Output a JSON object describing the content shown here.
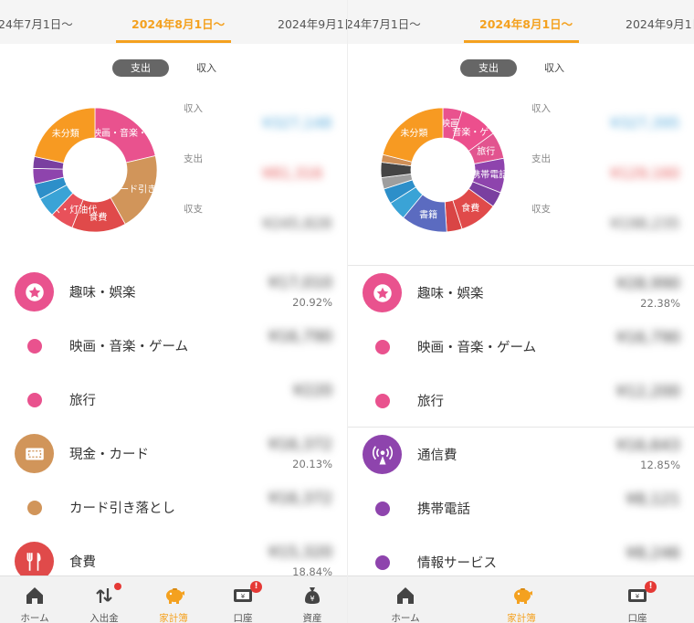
{
  "colors": {
    "accent": "#f4a11f",
    "income": "#4aa3d8",
    "expense": "#e35050",
    "balance": "#555555",
    "hobby": "#e9528e",
    "cash_card": "#d1955a",
    "food": "#e04a4a",
    "telecom": "#8e44ad",
    "uncategorized": "#f79a22",
    "books": "#5b6bc0"
  },
  "left": {
    "date_tabs": {
      "prev": "24年7月1日〜",
      "active": "2024年8月1日〜",
      "next": "2024年9月1日"
    },
    "toggle": {
      "expense": "支出",
      "income": "収入"
    },
    "donut": {
      "segments": [
        {
          "label": "映画・音楽・ゲ",
          "color": "#e9528e",
          "share": 0.2092
        },
        {
          "label": "カード引き落",
          "color": "#d1955a",
          "share": 0.2013
        },
        {
          "label": "食費",
          "color": "#e04a4a",
          "share": 0.1384
        },
        {
          "label": "ガス・灯油代",
          "color": "#e8515a",
          "share": 0.06
        },
        {
          "label": "",
          "color": "#3aa3d6",
          "share": 0.05
        },
        {
          "label": "",
          "color": "#2d8fc9",
          "share": 0.04
        },
        {
          "label": "",
          "color": "#8e44ad",
          "share": 0.04
        },
        {
          "label": "",
          "color": "#7a3fa0",
          "share": 0.03
        },
        {
          "label": "未分類",
          "color": "#f79a22",
          "share": 0.2111
        }
      ]
    },
    "summary": {
      "income": {
        "label": "収入",
        "value": "¥327,148"
      },
      "expense": {
        "label": "支出",
        "value": "¥81,316"
      },
      "balance": {
        "label": "収支",
        "value": "¥245,828"
      }
    },
    "rows": [
      {
        "kind": "category",
        "icon": "star-icon",
        "color": "#e9528e",
        "name": "趣味・娯楽",
        "amount": "¥17,010",
        "pct": "20.92%"
      },
      {
        "kind": "sub",
        "color": "#e9528e",
        "name": "映画・音楽・ゲーム",
        "amount": "¥16,790",
        "pct": ""
      },
      {
        "kind": "sub",
        "color": "#e9528e",
        "name": "旅行",
        "amount": "¥220",
        "pct": ""
      },
      {
        "kind": "category",
        "icon": "wallet-icon",
        "color": "#d1955a",
        "name": "現金・カード",
        "amount": "¥16,372",
        "pct": "20.13%"
      },
      {
        "kind": "sub",
        "color": "#d1955a",
        "name": "カード引き落とし",
        "amount": "¥16,372",
        "pct": ""
      },
      {
        "kind": "category",
        "icon": "cutlery-icon",
        "color": "#e04a4a",
        "name": "食費",
        "amount": "¥15,320",
        "pct": "18.84%"
      }
    ],
    "nav": [
      {
        "label": "ホーム",
        "icon": "home-icon"
      },
      {
        "label": "入出金",
        "icon": "transfer-icon"
      },
      {
        "label": "家計簿",
        "icon": "piggy-bank-icon"
      },
      {
        "label": "口座",
        "icon": "account-icon"
      },
      {
        "label": "資産",
        "icon": "money-bag-icon"
      }
    ]
  },
  "right": {
    "date_tabs": {
      "prev": "24年7月1日〜",
      "active": "2024年8月1日〜",
      "next": "2024年9月1日"
    },
    "toggle": {
      "expense": "支出",
      "income": "収入"
    },
    "donut": {
      "segments": [
        {
          "label": "映画",
          "color": "#e9528e",
          "share": 0.05
        },
        {
          "label": "音楽・ゲ",
          "color": "#ec4f8d",
          "share": 0.1
        },
        {
          "label": "旅行",
          "color": "#e2548f",
          "share": 0.07
        },
        {
          "label": "携帯電話",
          "color": "#8e44ad",
          "share": 0.09
        },
        {
          "label": "",
          "color": "#7a3fa0",
          "share": 0.04
        },
        {
          "label": "食費",
          "color": "#e04a4a",
          "share": 0.1
        },
        {
          "label": "",
          "color": "#d94545",
          "share": 0.04
        },
        {
          "label": "書籍",
          "color": "#5b6bc0",
          "share": 0.12
        },
        {
          "label": "",
          "color": "#3aa3d6",
          "share": 0.05
        },
        {
          "label": "",
          "color": "#2d8fc9",
          "share": 0.04
        },
        {
          "label": "",
          "color": "#9e9e9e",
          "share": 0.03
        },
        {
          "label": "",
          "color": "#444444",
          "share": 0.04
        },
        {
          "label": "",
          "color": "#cf8f57",
          "share": 0.02
        },
        {
          "label": "未分類",
          "color": "#f79a22",
          "share": 0.21
        }
      ]
    },
    "summary": {
      "income": {
        "label": "収入",
        "value": "¥327,395"
      },
      "expense": {
        "label": "支出",
        "value": "¥129,160"
      },
      "balance": {
        "label": "収支",
        "value": "¥198,235"
      }
    },
    "rows": [
      {
        "kind": "category",
        "icon": "star-icon",
        "color": "#e9528e",
        "name": "趣味・娯楽",
        "amount": "¥28,990",
        "pct": "22.38%"
      },
      {
        "kind": "sub",
        "color": "#e9528e",
        "name": "映画・音楽・ゲーム",
        "amount": "¥16,790",
        "pct": ""
      },
      {
        "kind": "sub",
        "color": "#e9528e",
        "name": "旅行",
        "amount": "¥12,200",
        "pct": ""
      },
      {
        "kind": "category",
        "icon": "antenna-icon",
        "color": "#8e44ad",
        "name": "通信費",
        "amount": "¥16,643",
        "pct": "12.85%"
      },
      {
        "kind": "sub",
        "color": "#8e44ad",
        "name": "携帯電話",
        "amount": "¥8,121",
        "pct": ""
      },
      {
        "kind": "sub",
        "color": "#8e44ad",
        "name": "情報サービス",
        "amount": "¥8,246",
        "pct": ""
      }
    ],
    "nav": [
      {
        "label": "ホーム",
        "icon": "home-icon"
      },
      {
        "label": "家計簿",
        "icon": "piggy-bank-icon"
      },
      {
        "label": "口座",
        "icon": "account-icon"
      }
    ]
  }
}
